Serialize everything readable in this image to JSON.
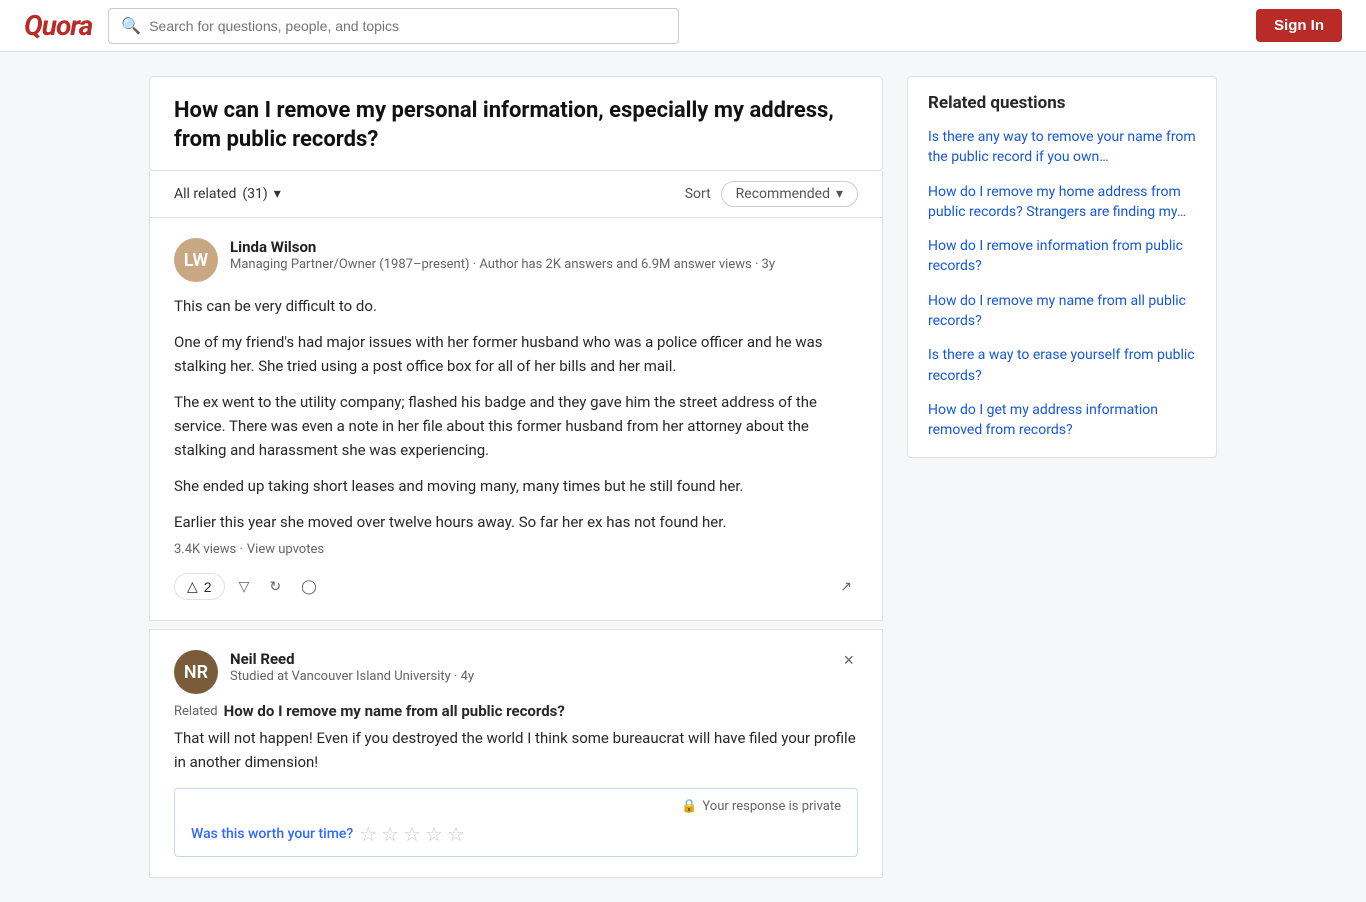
{
  "header": {
    "logo": "Quora",
    "search_placeholder": "Search for questions, people, and topics",
    "sign_in_label": "Sign In"
  },
  "question": {
    "title": "How can I remove my personal information, especially my address, from public records?"
  },
  "answers_header": {
    "all_related_label": "All related",
    "all_related_count": "(31)",
    "sort_label": "Sort",
    "sort_value": "Recommended"
  },
  "answers": [
    {
      "id": "linda-wilson",
      "author_name": "Linda Wilson",
      "author_meta": "Managing Partner/Owner (1987–present) · Author has 2K answers and 6.9M answer views · 3y",
      "author_initials": "LW",
      "paragraphs": [
        "This can be very difficult to do.",
        "One of my friend's had major issues with her former husband who was a police officer and he was stalking her. She tried using a post office box for all of her bills and her mail.",
        "The ex went to the utility company; flashed his badge and they gave him the street address of the service. There was even a note in her file about this former husband from her attorney about the stalking and harassment she was experiencing.",
        "She ended up taking short leases and moving many, many times but he still found her.",
        "Earlier this year she moved over twelve hours away. So far her ex has not found her."
      ],
      "stats": "3.4K views · View upvotes",
      "upvote_count": "2",
      "show_close": false
    },
    {
      "id": "neil-reed",
      "author_name": "Neil Reed",
      "author_meta": "Studied at Vancouver Island University · 4y",
      "author_initials": "NR",
      "related_label": "Related",
      "related_question": "How do I remove my name from all public records?",
      "paragraphs": [
        "That will not happen! Even if you destroyed the world I think some bureaucrat will have filed your profile in another dimension!"
      ],
      "show_close": true,
      "show_private": true,
      "worth_time_label": "Was this worth your time?"
    }
  ],
  "related_questions": {
    "title": "Related questions",
    "items": [
      {
        "text": "Is there any way to remove your name from the public record if you own…"
      },
      {
        "text": "How do I remove my home address from public records? Strangers are finding my…"
      },
      {
        "text": "How do I remove information from public records?"
      },
      {
        "text": "How do I remove my name from all public records?"
      },
      {
        "text": "Is there a way to erase yourself from public records?"
      },
      {
        "text": "How do I get my address information removed from records?"
      }
    ]
  },
  "icons": {
    "search": "🔍",
    "chevron_down": "▾",
    "upvote": "△",
    "downvote": "▽",
    "refresh": "↻",
    "comment": "◯",
    "share": "↗",
    "close": "×",
    "lock": "🔒"
  },
  "colors": {
    "quora_red": "#b92b27",
    "link_blue": "#1558d6",
    "text_dark": "#282829",
    "text_muted": "#636466"
  }
}
